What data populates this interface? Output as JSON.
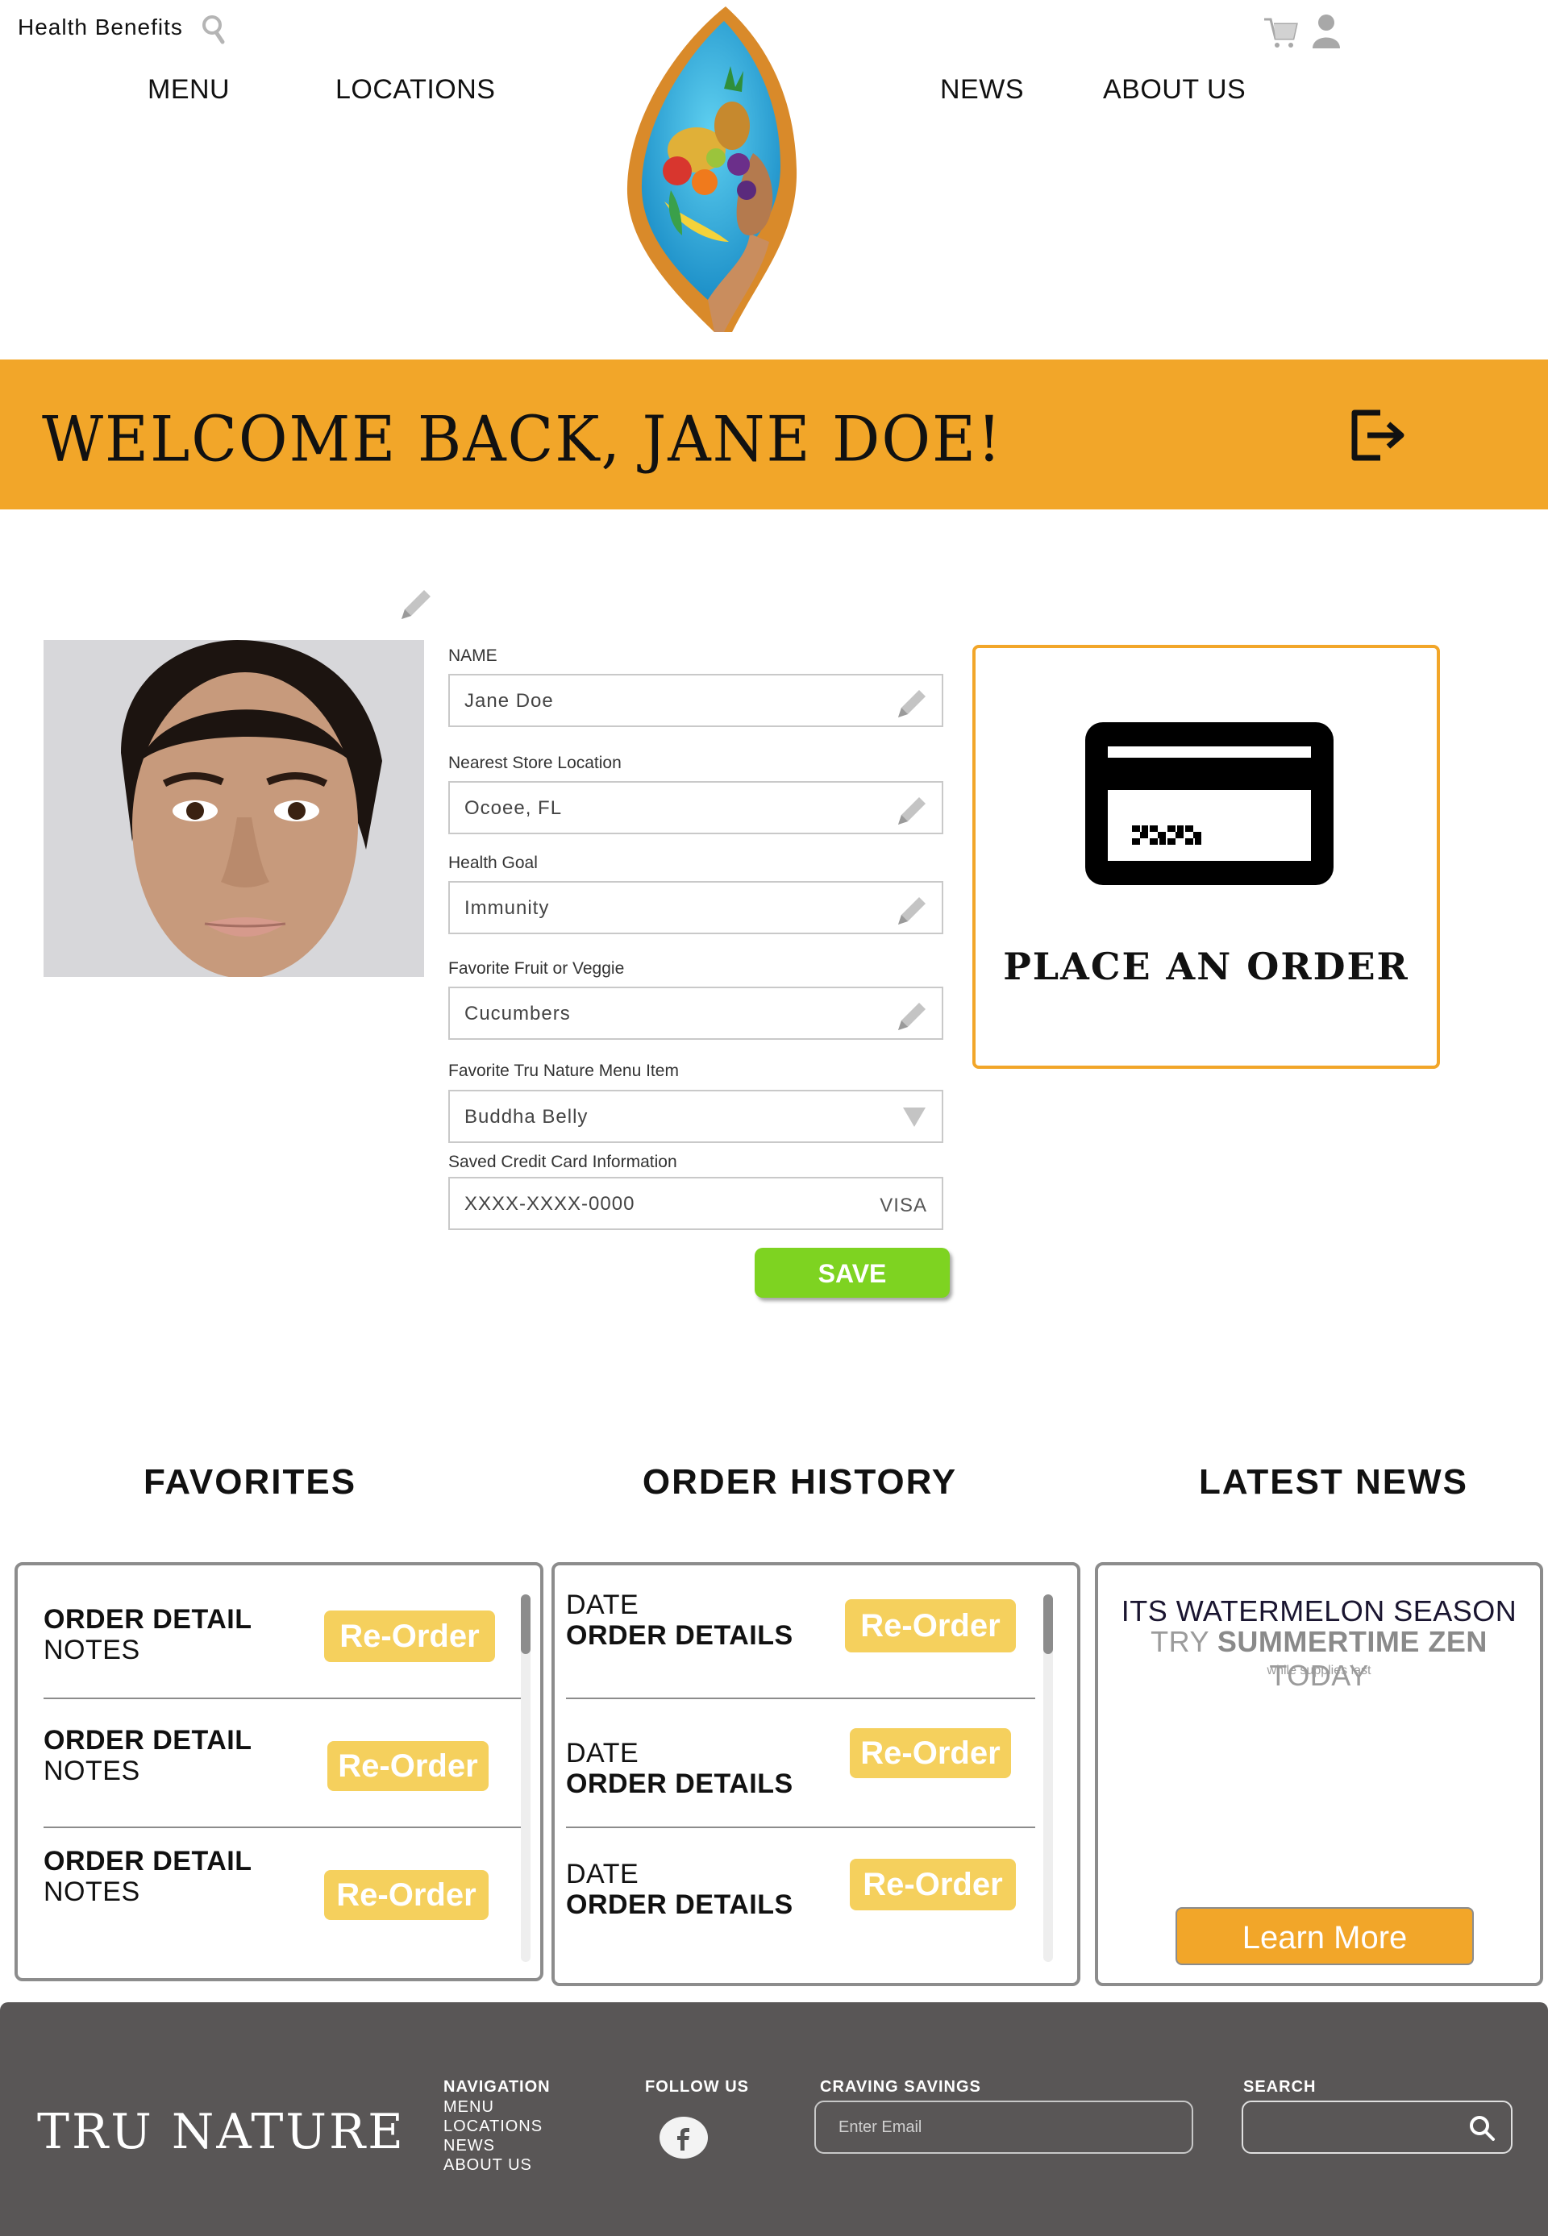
{
  "header": {
    "health_benefits": "Health Benefits",
    "nav": [
      "MENU",
      "LOCATIONS",
      "NEWS",
      "ABOUT US"
    ]
  },
  "banner": {
    "welcome": "WELCOME BACK, JANE DOE!",
    "color": "#f2a629"
  },
  "profile": {
    "fields": [
      {
        "label": "NAME",
        "value": "Jane Doe"
      },
      {
        "label": "Nearest Store Location",
        "value": "Ocoee, FL"
      },
      {
        "label": "Health Goal",
        "value": "Immunity"
      },
      {
        "label": "Favorite Fruit or Veggie",
        "value": "Cucumbers"
      },
      {
        "label": "Favorite Tru Nature Menu Item",
        "value": "Buddha Belly"
      },
      {
        "label": "Saved Credit Card Information",
        "value": "XXXX-XXXX-0000",
        "card_type": "VISA"
      }
    ],
    "save_label": "SAVE"
  },
  "order_card": {
    "label": "PLACE AN ORDER"
  },
  "sections": {
    "favorites": "FAVORITES",
    "order_history": "ORDER HISTORY",
    "latest_news": "LATEST NEWS"
  },
  "favorites": [
    {
      "title": "ORDER DETAIL",
      "notes": "NOTES",
      "button": "Re-Order"
    },
    {
      "title": "ORDER DETAIL",
      "notes": "NOTES",
      "button": "Re-Order"
    },
    {
      "title": "ORDER DETAIL",
      "notes": "NOTES",
      "button": "Re-Order"
    }
  ],
  "order_history": [
    {
      "date": "DATE",
      "details": "ORDER DETAILS",
      "button": "Re-Order"
    },
    {
      "date": "DATE",
      "details": "ORDER DETAILS",
      "button": "Re-Order"
    },
    {
      "date": "DATE",
      "details": "ORDER DETAILS",
      "button": "Re-Order"
    }
  ],
  "news": {
    "line1": "ITS WATERMELON SEASON",
    "line2_pre": "TRY ",
    "line2_bold": "SUMMERTIME ZEN",
    "line2_post": " TODAY",
    "line3": "while supplies last",
    "button": "Learn More"
  },
  "footer": {
    "brand": "TRU NATURE",
    "nav_heading": "NAVIGATION",
    "nav_links": [
      "MENU",
      "LOCATIONS",
      "NEWS",
      "ABOUT US"
    ],
    "follow_heading": "FOLLOW US",
    "savings_heading": "CRAVING SAVINGS",
    "email_placeholder": "Enter Email",
    "search_heading": "SEARCH"
  }
}
